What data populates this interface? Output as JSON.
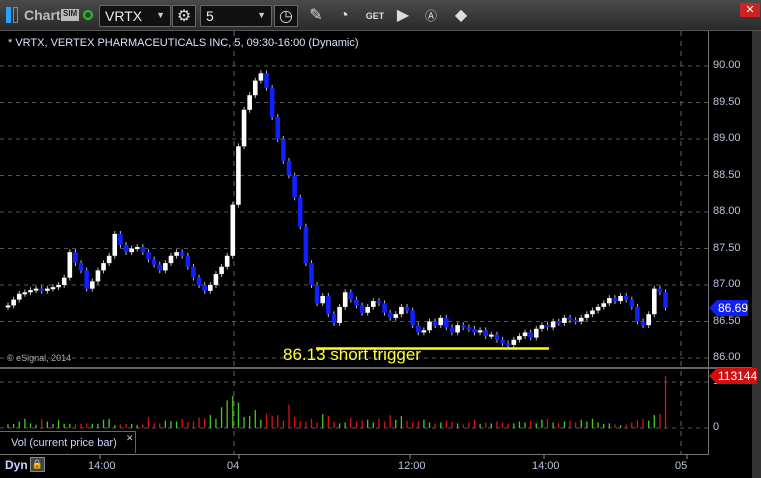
{
  "toolbar": {
    "app_label": "Chart",
    "sim_badge": "SIM",
    "symbol": "VRTX",
    "interval": "5",
    "icons": [
      "settings-gear-icon",
      "clock-icon",
      "pencil-icon",
      "indicator-icon",
      "get-icon",
      "play-icon",
      "alert-icon",
      "link-icon"
    ]
  },
  "chart": {
    "title": "* VRTX, VERTEX PHARMACEUTICALS INC, 5, 09:30-16:00 (Dynamic)",
    "copyright": "© eSignal, 2014",
    "annotation": "86.13 short trigger",
    "annotation_price": 86.13,
    "last_price": "86.69",
    "last_volume": "113144",
    "volume_study": "Vol (current price bar)",
    "dyn_label": "Dyn"
  },
  "chart_data": {
    "type": "candlestick",
    "price_ticks": [
      "90.00",
      "89.50",
      "89.00",
      "88.50",
      "88.00",
      "87.50",
      "87.00",
      "86.50",
      "86.00"
    ],
    "volume_ticks": [
      "100000",
      "0"
    ],
    "time_ticks": [
      "14:00",
      "04",
      "12:00",
      "14:00",
      "05"
    ],
    "ylim": [
      86.0,
      90.0
    ],
    "colors": {
      "up": "#ffffff",
      "down": "#1020ff",
      "vol_up": "#44cc22",
      "vol_down": "#dd1111",
      "annotation": "#ffff00"
    },
    "closes": [
      86.72,
      86.8,
      86.88,
      86.9,
      86.93,
      86.95,
      86.92,
      86.95,
      86.97,
      87.0,
      87.1,
      87.45,
      87.3,
      87.2,
      86.95,
      87.05,
      87.2,
      87.3,
      87.4,
      87.7,
      87.55,
      87.45,
      87.5,
      87.52,
      87.45,
      87.35,
      87.28,
      87.2,
      87.3,
      87.4,
      87.45,
      87.4,
      87.25,
      87.1,
      87.0,
      86.92,
      87.0,
      87.15,
      87.25,
      87.4,
      88.1,
      88.9,
      89.4,
      89.6,
      89.8,
      89.9,
      89.7,
      89.3,
      89.0,
      88.7,
      88.5,
      88.2,
      87.8,
      87.3,
      87.0,
      86.75,
      86.85,
      86.6,
      86.48,
      86.7,
      86.9,
      86.8,
      86.72,
      86.62,
      86.7,
      86.78,
      86.75,
      86.62,
      86.55,
      86.6,
      86.7,
      86.65,
      86.45,
      86.35,
      86.38,
      86.5,
      86.45,
      86.55,
      86.42,
      86.35,
      86.45,
      86.42,
      86.4,
      86.35,
      86.38,
      86.3,
      86.32,
      86.25,
      86.2,
      86.18,
      86.25,
      86.3,
      86.35,
      86.28,
      86.4,
      86.45,
      86.42,
      86.5,
      86.48,
      86.55,
      86.52,
      86.5,
      86.55,
      86.6,
      86.65,
      86.7,
      86.75,
      86.82,
      86.78,
      86.85,
      86.8,
      86.7,
      86.5,
      86.45,
      86.6,
      86.95,
      86.9,
      86.69
    ],
    "volumes": [
      8000,
      9000,
      14000,
      20000,
      10000,
      7000,
      19000,
      14000,
      9000,
      17000,
      9000,
      9000,
      8000,
      9000,
      10000,
      9000,
      9000,
      18000,
      20000,
      6000,
      8000,
      9000,
      9000,
      7000,
      8000,
      24000,
      10000,
      10000,
      16000,
      15000,
      14000,
      20000,
      13000,
      14000,
      23000,
      21000,
      28000,
      20000,
      45000,
      60000,
      70000,
      55000,
      24000,
      26000,
      39000,
      18000,
      31000,
      26000,
      28000,
      16000,
      51000,
      24000,
      15000,
      14000,
      20000,
      12000,
      30000,
      26000,
      14000,
      10000,
      12000,
      22000,
      14000,
      16000,
      18000,
      12000,
      20000,
      14000,
      28000,
      18000,
      26000,
      16000,
      12000,
      14000,
      18000,
      12000,
      10000,
      12000,
      16000,
      14000,
      10000,
      8000,
      12000,
      18000,
      9000,
      12000,
      10000,
      14000,
      12000,
      9000,
      10000,
      14000,
      12000,
      16000,
      10000,
      18000,
      20000,
      12000,
      10000,
      14000,
      16000,
      12000,
      18000,
      14000,
      20000,
      12000,
      9000,
      10000,
      8000,
      6000,
      8000,
      12000,
      17000,
      20000,
      16000,
      28000,
      31000,
      113144
    ]
  }
}
